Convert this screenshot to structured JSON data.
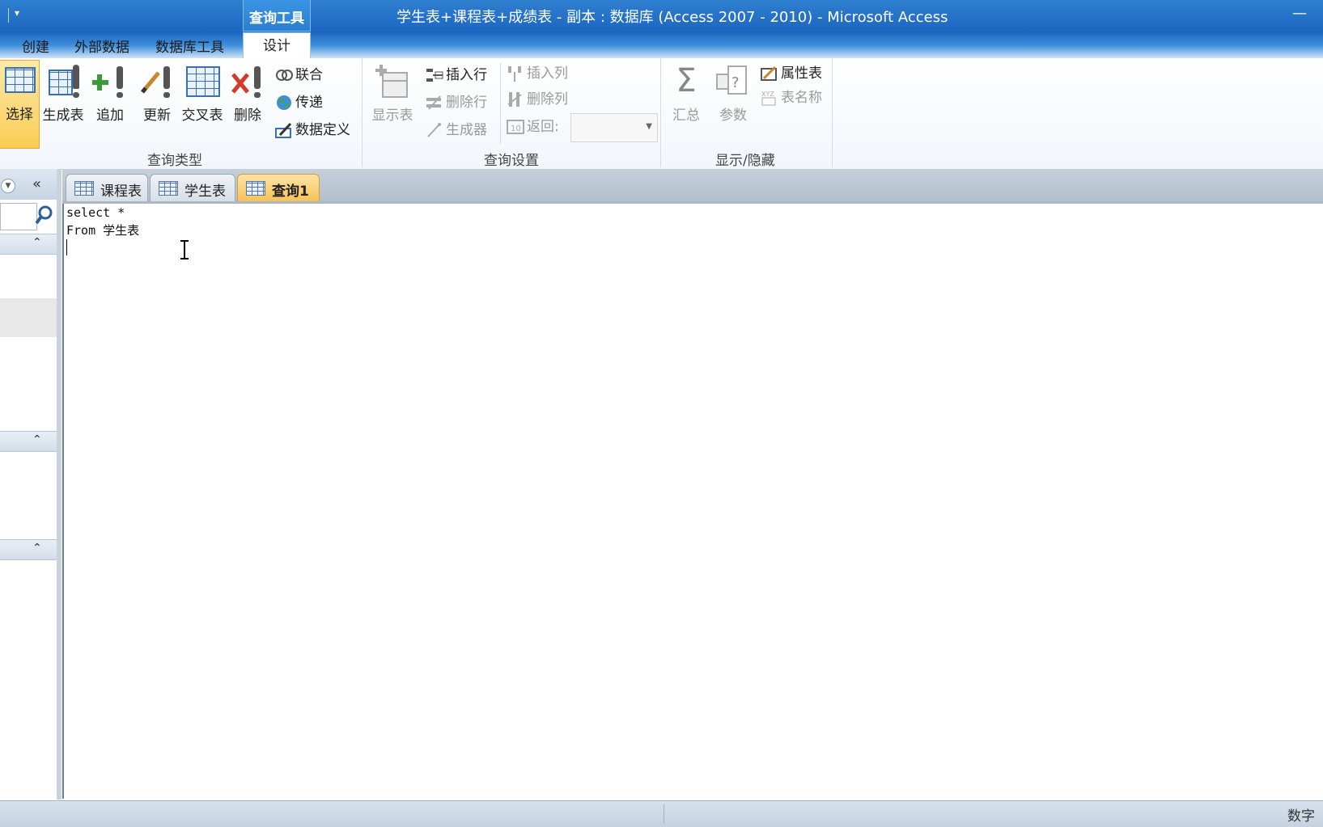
{
  "titlebar": {
    "context_group": "查询工具",
    "window_title": "学生表+课程表+成绩表 - 副本 : 数据库 (Access 2007 - 2010)  -  Microsoft Access",
    "minimize_glyph": "—"
  },
  "ribbon_tabs": [
    "创建",
    "外部数据",
    "数据库工具",
    "设计"
  ],
  "active_tab": "设计",
  "ribbon": {
    "query_type": {
      "label": "查询类型",
      "buttons": [
        "选择",
        "生成表",
        "追加",
        "更新",
        "交叉表",
        "删除"
      ],
      "small_buttons": [
        "联合",
        "传递",
        "数据定义"
      ]
    },
    "query_setup": {
      "label": "查询设置",
      "show_table": "显示表",
      "insert_row": "插入行",
      "delete_row": "删除行",
      "builder": "生成器",
      "insert_column": "插入列",
      "delete_column": "删除列",
      "return_label": "返回:",
      "return_value": ""
    },
    "show_hide": {
      "label": "显示/隐藏",
      "totals": "汇总",
      "parameters": "参数",
      "property_sheet": "属性表",
      "table_names": "表名称"
    }
  },
  "navpane": {
    "collapse_glyph": "«",
    "search_placeholder": ""
  },
  "doc_tabs": [
    "课程表",
    "学生表",
    "查询1"
  ],
  "active_doc_tab": "查询1",
  "editor": {
    "lines": [
      "select *",
      "From 学生表"
    ]
  },
  "statusbar": {
    "mode": "数字"
  },
  "colors": {
    "title_blue": "#1c66c0",
    "active_orange": "#f9cd55"
  }
}
